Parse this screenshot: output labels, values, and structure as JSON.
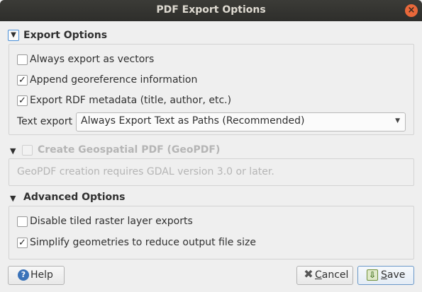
{
  "window": {
    "title": "PDF Export Options",
    "close_glyph": "×"
  },
  "export_options": {
    "title": "Export Options",
    "checkboxes": [
      {
        "label": "Always export as vectors",
        "checked": false
      },
      {
        "label": "Append georeference information",
        "checked": true
      },
      {
        "label": "Export RDF metadata (title, author, etc.)",
        "checked": true
      }
    ],
    "text_export_label": "Text export",
    "text_export_value": "Always Export Text as Paths (Recommended)"
  },
  "geopdf": {
    "title": "Create Geospatial PDF (GeoPDF)",
    "checked": false,
    "enabled": false,
    "message": "GeoPDF creation requires GDAL version 3.0 or later."
  },
  "advanced_options": {
    "title": "Advanced Options",
    "checkboxes": [
      {
        "label": "Disable tiled raster layer exports",
        "checked": false
      },
      {
        "label": "Simplify geometries to reduce output file size",
        "checked": true
      }
    ]
  },
  "buttons": {
    "help": "Help",
    "cancel_prefix": "",
    "cancel_mnemonic": "C",
    "cancel_rest": "ancel",
    "save_mnemonic": "S",
    "save_rest": "ave"
  },
  "colors": {
    "titlebar": "#2e2e2b",
    "close": "#e9683a",
    "focus": "#4a90d9"
  }
}
